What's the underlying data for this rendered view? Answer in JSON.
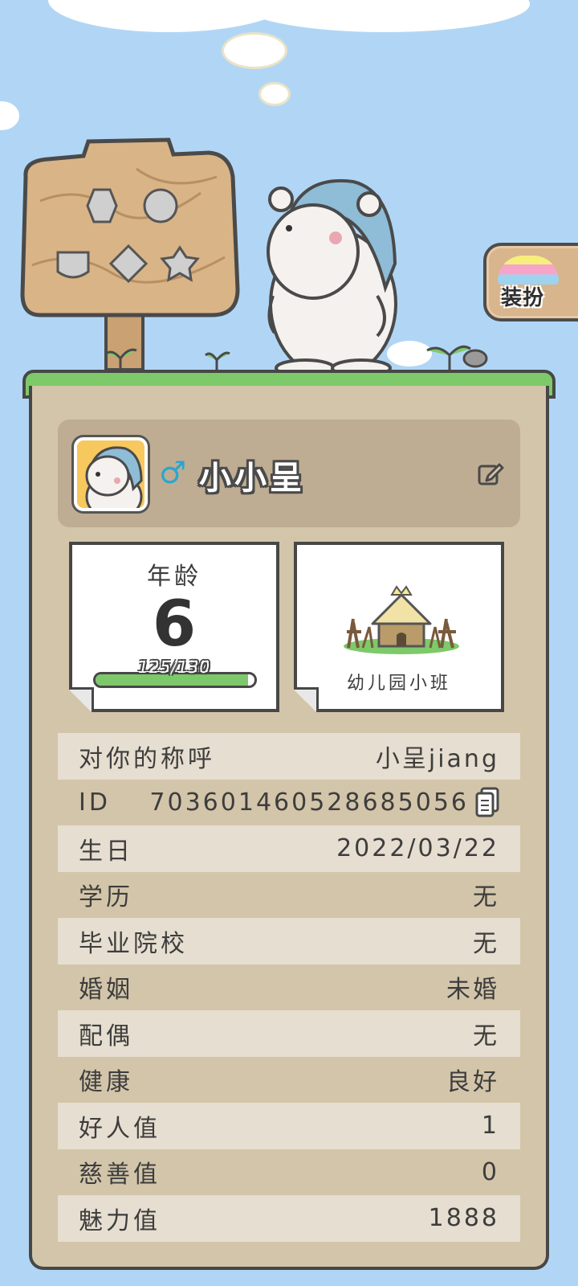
{
  "dress_button": {
    "label": "装扮"
  },
  "profile": {
    "gender_symbol": "♂",
    "nickname": "小小呈"
  },
  "age_card": {
    "title": "年龄",
    "value": "6",
    "progress_text": "125/130",
    "progress_fraction": 0.96
  },
  "school_card": {
    "label": "幼儿园小班"
  },
  "info_rows": [
    {
      "label": "对你的称呼",
      "value": "小呈jiang"
    },
    {
      "label": "ID",
      "value": "70360146052868​5056"
    },
    {
      "label": "生日",
      "value": "2022/03/22"
    },
    {
      "label": "学历",
      "value": "无"
    },
    {
      "label": "毕业院校",
      "value": "无"
    },
    {
      "label": "婚姻",
      "value": "未婚"
    },
    {
      "label": "配偶",
      "value": "无"
    },
    {
      "label": "健康",
      "value": "良好"
    },
    {
      "label": "好人值",
      "value": "1"
    },
    {
      "label": "慈善值",
      "value": "0"
    },
    {
      "label": "魅力值",
      "value": "1888"
    }
  ],
  "colors": {
    "sky": "#b1d6f5",
    "grass": "#7ec96a",
    "panel": "#d3c5aa",
    "gender_blue": "#2ca6cc"
  }
}
